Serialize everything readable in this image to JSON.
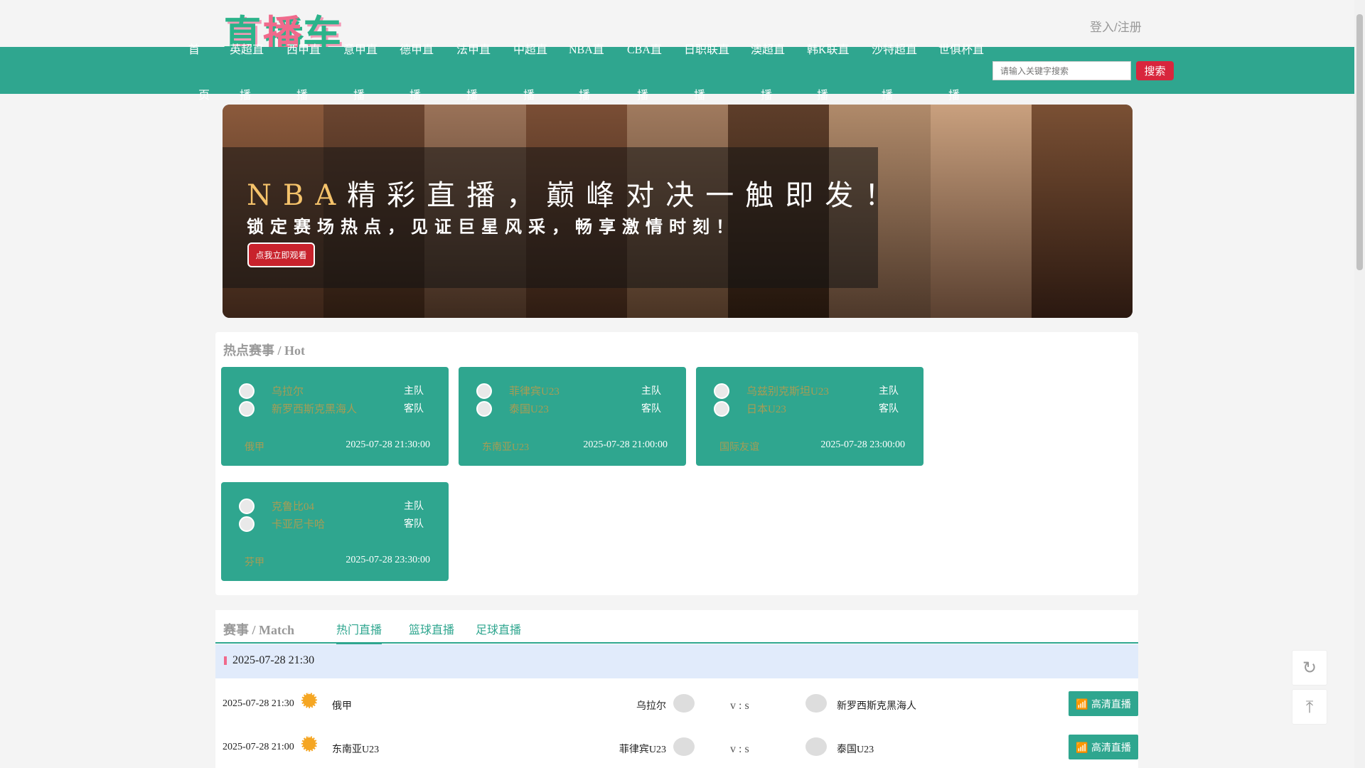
{
  "header": {
    "logo_text": "直播车",
    "login": "登入/注册"
  },
  "nav": [
    {
      "t1": "首",
      "t2": "页"
    },
    {
      "t1": "英超直",
      "t2": "播"
    },
    {
      "t1": "西甲直",
      "t2": "播"
    },
    {
      "t1": "意甲直",
      "t2": "播"
    },
    {
      "t1": "德甲直",
      "t2": "播"
    },
    {
      "t1": "法甲直",
      "t2": "播"
    },
    {
      "t1": "中超直",
      "t2": "播"
    },
    {
      "t1": "NBA直",
      "t2": "播"
    },
    {
      "t1": "CBA直",
      "t2": "播"
    },
    {
      "t1": "日职联直",
      "t2": "播"
    },
    {
      "t1": "澳超直",
      "t2": "播"
    },
    {
      "t1": "韩K联直",
      "t2": "播"
    },
    {
      "t1": "沙特超直",
      "t2": "播"
    },
    {
      "t1": "世俱杯直",
      "t2": "播"
    }
  ],
  "search": {
    "placeholder": "请输入关键字搜索",
    "button": "搜索"
  },
  "banner": {
    "headline_a": "NBA",
    "headline_b": "精彩直播，巅峰对决一触即发！",
    "sub": "锁定赛场热点，见证巨星风采，畅享激情时刻！",
    "button": "点我立即观看"
  },
  "hot": {
    "title": "热点赛事 / Hot",
    "home_label": "主队",
    "away_label": "客队",
    "cards": [
      {
        "home": "乌拉尔",
        "away": "新罗西斯克黑海人",
        "league": "俄甲",
        "time": "2025-07-28 21:30:00"
      },
      {
        "home": "菲律宾U23",
        "away": "泰国U23",
        "league": "东南亚U23",
        "time": "2025-07-28 21:00:00"
      },
      {
        "home": "乌兹别克斯坦U23",
        "away": "日本U23",
        "league": "国际友谊",
        "time": "2025-07-28 23:00:00"
      },
      {
        "home": "克鲁比04",
        "away": "卡亚尼卡哈",
        "league": "芬甲",
        "time": "2025-07-28 23:30:00"
      }
    ]
  },
  "match": {
    "title": "赛事 / Match",
    "tabs": [
      "热门直播",
      "篮球直播",
      "足球直播"
    ],
    "date": "2025-07-28 21:30",
    "vs": "v : s",
    "live_label": "高清直播",
    "rows": [
      {
        "time": "2025-07-28 21:30",
        "league": "俄甲",
        "home": "乌拉尔",
        "away": "新罗西斯克黑海人"
      },
      {
        "time": "2025-07-28 21:00",
        "league": "东南亚U23",
        "home": "菲律宾U23",
        "away": "泰国U23"
      }
    ]
  },
  "float": {
    "refresh": "↻",
    "top": "⤒"
  },
  "colors": {
    "accent": "#2fa68f",
    "danger": "#d8263d",
    "highlight": "#f5c36b"
  }
}
